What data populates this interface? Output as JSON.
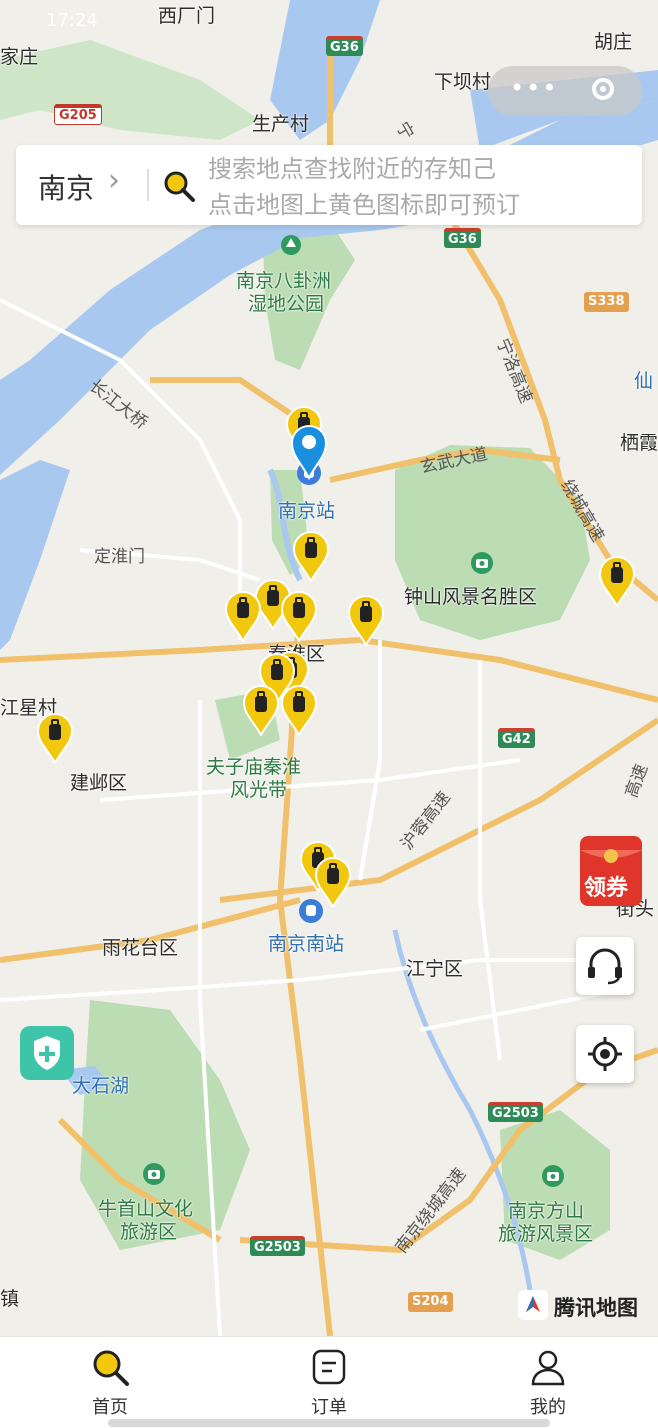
{
  "status_bar": {
    "time": "17:24"
  },
  "search": {
    "city": "南京",
    "placeholder_line1": "搜索地点查找附近的存知己",
    "placeholder_line2": "点击地图上黄色图标即可预订"
  },
  "map": {
    "places": {
      "xiguanmen": "西厂门",
      "jiazhuang": "家庄",
      "huzhuang": "胡庄",
      "xiabacun": "下坝村",
      "shengchancun": "生产村",
      "bagua_1": "南京八卦洲",
      "bagua_2": "湿地公园",
      "changjiang": "长江大桥",
      "xuanwu": "玄武大道",
      "nanjing_station": "南京站",
      "dinghuai": "定淮门",
      "zhongshan": "钟山风景名胜区",
      "qinhuai": "秦淮区",
      "xingcun": "江星村",
      "jianye": "建邺区",
      "fuzimiao_1": "夫子庙秦淮",
      "fuzimiao_2": "风光带",
      "yuhua": "雨花台区",
      "nanjing_south": "南京南站",
      "jiangning": "江宁区",
      "dashihu": "大石湖",
      "niushou_1": "牛首山文化",
      "niushou_2": "旅游区",
      "fangshan_1": "南京方山",
      "fangshan_2": "旅游风景区",
      "qixia": "栖霞",
      "xian": "仙",
      "jiekou": "街头",
      "zhen": "镇"
    },
    "roads": {
      "ningluo": "宁洛高速",
      "raocheng": "绕城高速",
      "hurong": "沪蓉高速",
      "nanjing_raocheng": "南京绕城高速",
      "ning": "宁",
      "gaosu_r": "高速"
    },
    "shields": {
      "g36a": "G36",
      "g36b": "G36",
      "g205": "G205",
      "s338": "S338",
      "g42": "G42",
      "g2503a": "G2503",
      "g2503b": "G2503",
      "s204": "S204"
    },
    "provider": "腾讯地图"
  },
  "fab": {
    "coupon": "领券"
  },
  "tabs": [
    {
      "label": "首页",
      "icon": "search-icon"
    },
    {
      "label": "订单",
      "icon": "order-icon"
    },
    {
      "label": "我的",
      "icon": "user-icon"
    }
  ],
  "colors": {
    "pin_yellow": "#f2c80f",
    "pin_blue": "#1a8fe0",
    "coupon_red": "#e0352b",
    "shield_green": "#3ec4a8"
  }
}
